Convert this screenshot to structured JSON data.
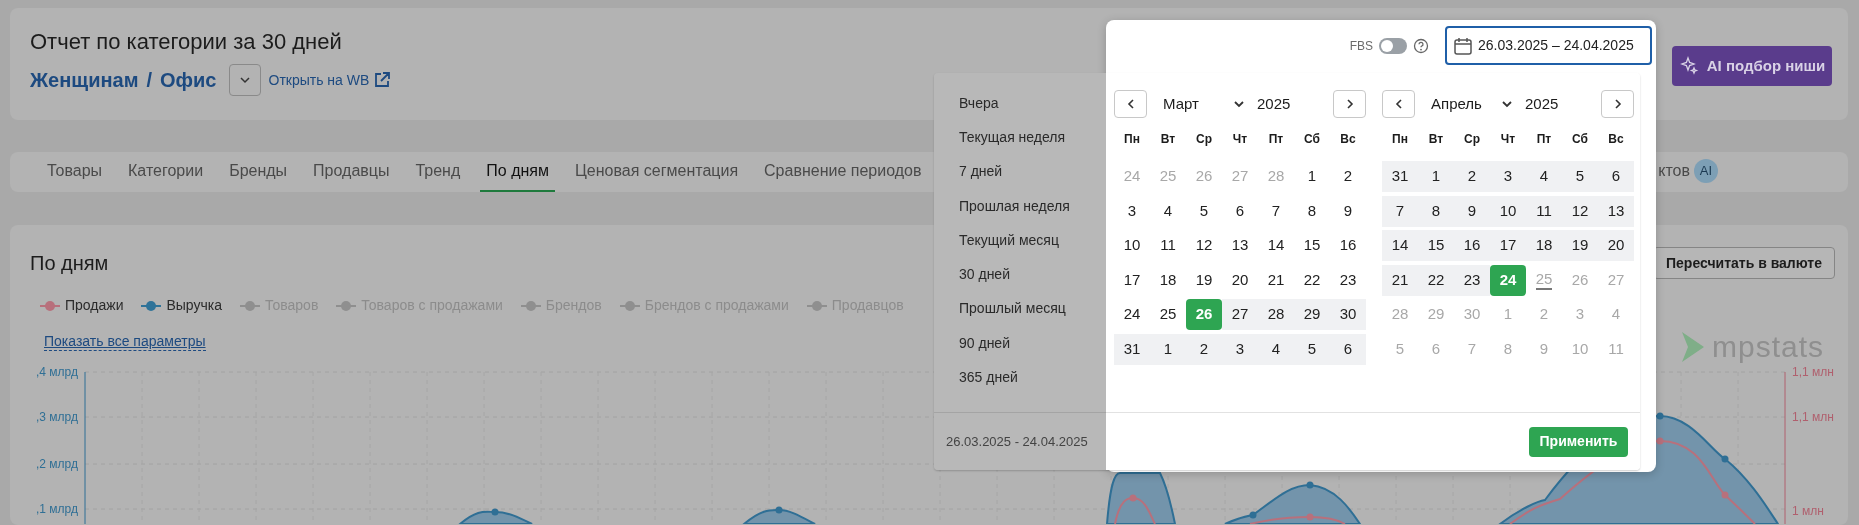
{
  "header": {
    "title": "Отчет по категории за 30 дней",
    "breadcrumb": [
      "Женщинам",
      "Офис"
    ],
    "separator": "/",
    "open_link": "Открыть на WB",
    "ai_button": "AI подбор ниши"
  },
  "tabs": [
    {
      "label": "Товары",
      "selected": false
    },
    {
      "label": "Категории",
      "selected": false
    },
    {
      "label": "Бренды",
      "selected": false
    },
    {
      "label": "Продавцы",
      "selected": false
    },
    {
      "label": "Тренд",
      "selected": false
    },
    {
      "label": "По дням",
      "selected": true
    },
    {
      "label": "Ценовая сегментация",
      "selected": false
    },
    {
      "label": "Сравнение периодов",
      "selected": false
    },
    {
      "label": "ктов",
      "selected": false,
      "badge": "AI"
    }
  ],
  "panel": {
    "title": "По дням",
    "recalc_button": "Пересчитать в валюте",
    "legend": [
      {
        "label": "Продажи",
        "on": true,
        "color": "#b8707c"
      },
      {
        "label": "Выручка",
        "on": true,
        "color": "#2f7399"
      },
      {
        "label": "Товаров",
        "on": false,
        "color": "#8f8f8f"
      },
      {
        "label": "Товаров с продажами",
        "on": false,
        "color": "#8f8f8f"
      },
      {
        "label": "Брендов",
        "on": false,
        "color": "#8f8f8f"
      },
      {
        "label": "Брендов с продажами",
        "on": false,
        "color": "#8f8f8f"
      },
      {
        "label": "Продавцов",
        "on": false,
        "color": "#8f8f8f"
      }
    ],
    "show_all_link": "Показать все параметры",
    "logo": "mpstats",
    "chart": {
      "left_ticks": [
        ",4 млрд",
        ",3 млрд",
        ",2 млрд",
        ",1 млрд"
      ],
      "right_ticks": [
        "1,1 млн",
        "1,1 млн",
        "1 млн"
      ]
    }
  },
  "date_picker": {
    "fbs_label": "FBS",
    "fbs_on": false,
    "value": "26.03.2025 – 24.04.2025",
    "presets": [
      "Вчера",
      "Текущая неделя",
      "7 дней",
      "Прошлая неделя",
      "Текущий месяц",
      "30 дней",
      "Прошлый месяц",
      "90 дней",
      "365 дней"
    ],
    "footer_range": "26.03.2025 - 24.04.2025",
    "apply_button": "Применить",
    "months": [
      {
        "month": "Март",
        "year": "2025",
        "weekdays": [
          "Пн",
          "Вт",
          "Ср",
          "Чт",
          "Пт",
          "Сб",
          "Вс"
        ],
        "weeks": [
          [
            {
              "day": "24",
              "muted": true,
              "in_range": false,
              "selected": false,
              "today": false
            },
            {
              "day": "25",
              "muted": true,
              "in_range": false,
              "selected": false,
              "today": false
            },
            {
              "day": "26",
              "muted": true,
              "in_range": false,
              "selected": false,
              "today": false
            },
            {
              "day": "27",
              "muted": true,
              "in_range": false,
              "selected": false,
              "today": false
            },
            {
              "day": "28",
              "muted": true,
              "in_range": false,
              "selected": false,
              "today": false
            },
            {
              "day": "1",
              "muted": false,
              "in_range": false,
              "selected": false,
              "today": false
            },
            {
              "day": "2",
              "muted": false,
              "in_range": false,
              "selected": false,
              "today": false
            }
          ],
          [
            {
              "day": "3",
              "muted": false,
              "in_range": false,
              "selected": false,
              "today": false
            },
            {
              "day": "4",
              "muted": false,
              "in_range": false,
              "selected": false,
              "today": false
            },
            {
              "day": "5",
              "muted": false,
              "in_range": false,
              "selected": false,
              "today": false
            },
            {
              "day": "6",
              "muted": false,
              "in_range": false,
              "selected": false,
              "today": false
            },
            {
              "day": "7",
              "muted": false,
              "in_range": false,
              "selected": false,
              "today": false
            },
            {
              "day": "8",
              "muted": false,
              "in_range": false,
              "selected": false,
              "today": false
            },
            {
              "day": "9",
              "muted": false,
              "in_range": false,
              "selected": false,
              "today": false
            }
          ],
          [
            {
              "day": "10",
              "muted": false,
              "in_range": false,
              "selected": false,
              "today": false
            },
            {
              "day": "11",
              "muted": false,
              "in_range": false,
              "selected": false,
              "today": false
            },
            {
              "day": "12",
              "muted": false,
              "in_range": false,
              "selected": false,
              "today": false
            },
            {
              "day": "13",
              "muted": false,
              "in_range": false,
              "selected": false,
              "today": false
            },
            {
              "day": "14",
              "muted": false,
              "in_range": false,
              "selected": false,
              "today": false
            },
            {
              "day": "15",
              "muted": false,
              "in_range": false,
              "selected": false,
              "today": false
            },
            {
              "day": "16",
              "muted": false,
              "in_range": false,
              "selected": false,
              "today": false
            }
          ],
          [
            {
              "day": "17",
              "muted": false,
              "in_range": false,
              "selected": false,
              "today": false
            },
            {
              "day": "18",
              "muted": false,
              "in_range": false,
              "selected": false,
              "today": false
            },
            {
              "day": "19",
              "muted": false,
              "in_range": false,
              "selected": false,
              "today": false
            },
            {
              "day": "20",
              "muted": false,
              "in_range": false,
              "selected": false,
              "today": false
            },
            {
              "day": "21",
              "muted": false,
              "in_range": false,
              "selected": false,
              "today": false
            },
            {
              "day": "22",
              "muted": false,
              "in_range": false,
              "selected": false,
              "today": false
            },
            {
              "day": "23",
              "muted": false,
              "in_range": false,
              "selected": false,
              "today": false
            }
          ],
          [
            {
              "day": "24",
              "muted": false,
              "in_range": false,
              "selected": false,
              "today": false
            },
            {
              "day": "25",
              "muted": false,
              "in_range": false,
              "selected": false,
              "today": false
            },
            {
              "day": "26",
              "muted": false,
              "in_range": true,
              "selected": true,
              "today": false
            },
            {
              "day": "27",
              "muted": false,
              "in_range": true,
              "selected": false,
              "today": false
            },
            {
              "day": "28",
              "muted": false,
              "in_range": true,
              "selected": false,
              "today": false
            },
            {
              "day": "29",
              "muted": false,
              "in_range": true,
              "selected": false,
              "today": false
            },
            {
              "day": "30",
              "muted": false,
              "in_range": true,
              "selected": false,
              "today": false
            }
          ],
          [
            {
              "day": "31",
              "muted": false,
              "in_range": true,
              "selected": false,
              "today": false
            },
            {
              "day": "1",
              "muted": false,
              "in_range": true,
              "selected": false,
              "today": false
            },
            {
              "day": "2",
              "muted": false,
              "in_range": true,
              "selected": false,
              "today": false
            },
            {
              "day": "3",
              "muted": false,
              "in_range": true,
              "selected": false,
              "today": false
            },
            {
              "day": "4",
              "muted": false,
              "in_range": true,
              "selected": false,
              "today": false
            },
            {
              "day": "5",
              "muted": false,
              "in_range": true,
              "selected": false,
              "today": false
            },
            {
              "day": "6",
              "muted": false,
              "in_range": true,
              "selected": false,
              "today": false
            }
          ]
        ]
      },
      {
        "month": "Апрель",
        "year": "2025",
        "weekdays": [
          "Пн",
          "Вт",
          "Ср",
          "Чт",
          "Пт",
          "Сб",
          "Вс"
        ],
        "weeks": [
          [
            {
              "day": "31",
              "muted": false,
              "in_range": true,
              "selected": false,
              "today": false
            },
            {
              "day": "1",
              "muted": false,
              "in_range": true,
              "selected": false,
              "today": false
            },
            {
              "day": "2",
              "muted": false,
              "in_range": true,
              "selected": false,
              "today": false
            },
            {
              "day": "3",
              "muted": false,
              "in_range": true,
              "selected": false,
              "today": false
            },
            {
              "day": "4",
              "muted": false,
              "in_range": true,
              "selected": false,
              "today": false
            },
            {
              "day": "5",
              "muted": false,
              "in_range": true,
              "selected": false,
              "today": false
            },
            {
              "day": "6",
              "muted": false,
              "in_range": true,
              "selected": false,
              "today": false
            }
          ],
          [
            {
              "day": "7",
              "muted": false,
              "in_range": true,
              "selected": false,
              "today": false
            },
            {
              "day": "8",
              "muted": false,
              "in_range": true,
              "selected": false,
              "today": false
            },
            {
              "day": "9",
              "muted": false,
              "in_range": true,
              "selected": false,
              "today": false
            },
            {
              "day": "10",
              "muted": false,
              "in_range": true,
              "selected": false,
              "today": false
            },
            {
              "day": "11",
              "muted": false,
              "in_range": true,
              "selected": false,
              "today": false
            },
            {
              "day": "12",
              "muted": false,
              "in_range": true,
              "selected": false,
              "today": false
            },
            {
              "day": "13",
              "muted": false,
              "in_range": true,
              "selected": false,
              "today": false
            }
          ],
          [
            {
              "day": "14",
              "muted": false,
              "in_range": true,
              "selected": false,
              "today": false
            },
            {
              "day": "15",
              "muted": false,
              "in_range": true,
              "selected": false,
              "today": false
            },
            {
              "day": "16",
              "muted": false,
              "in_range": true,
              "selected": false,
              "today": false
            },
            {
              "day": "17",
              "muted": false,
              "in_range": true,
              "selected": false,
              "today": false
            },
            {
              "day": "18",
              "muted": false,
              "in_range": true,
              "selected": false,
              "today": false
            },
            {
              "day": "19",
              "muted": false,
              "in_range": true,
              "selected": false,
              "today": false
            },
            {
              "day": "20",
              "muted": false,
              "in_range": true,
              "selected": false,
              "today": false
            }
          ],
          [
            {
              "day": "21",
              "muted": false,
              "in_range": true,
              "selected": false,
              "today": false
            },
            {
              "day": "22",
              "muted": false,
              "in_range": true,
              "selected": false,
              "today": false
            },
            {
              "day": "23",
              "muted": false,
              "in_range": true,
              "selected": false,
              "today": false
            },
            {
              "day": "24",
              "muted": false,
              "in_range": true,
              "selected": true,
              "today": false
            },
            {
              "day": "25",
              "muted": true,
              "in_range": false,
              "selected": false,
              "today": true
            },
            {
              "day": "26",
              "muted": true,
              "in_range": false,
              "selected": false,
              "today": false
            },
            {
              "day": "27",
              "muted": true,
              "in_range": false,
              "selected": false,
              "today": false
            }
          ],
          [
            {
              "day": "28",
              "muted": true,
              "in_range": false,
              "selected": false,
              "today": false
            },
            {
              "day": "29",
              "muted": true,
              "in_range": false,
              "selected": false,
              "today": false
            },
            {
              "day": "30",
              "muted": true,
              "in_range": false,
              "selected": false,
              "today": false
            },
            {
              "day": "1",
              "muted": true,
              "in_range": false,
              "selected": false,
              "today": false
            },
            {
              "day": "2",
              "muted": true,
              "in_range": false,
              "selected": false,
              "today": false
            },
            {
              "day": "3",
              "muted": true,
              "in_range": false,
              "selected": false,
              "today": false
            },
            {
              "day": "4",
              "muted": true,
              "in_range": false,
              "selected": false,
              "today": false
            }
          ],
          [
            {
              "day": "5",
              "muted": true,
              "in_range": false,
              "selected": false,
              "today": false
            },
            {
              "day": "6",
              "muted": true,
              "in_range": false,
              "selected": false,
              "today": false
            },
            {
              "day": "7",
              "muted": true,
              "in_range": false,
              "selected": false,
              "today": false
            },
            {
              "day": "8",
              "muted": true,
              "in_range": false,
              "selected": false,
              "today": false
            },
            {
              "day": "9",
              "muted": true,
              "in_range": false,
              "selected": false,
              "today": false
            },
            {
              "day": "10",
              "muted": true,
              "in_range": false,
              "selected": false,
              "today": false
            },
            {
              "day": "11",
              "muted": true,
              "in_range": false,
              "selected": false,
              "today": false
            }
          ]
        ]
      }
    ]
  }
}
